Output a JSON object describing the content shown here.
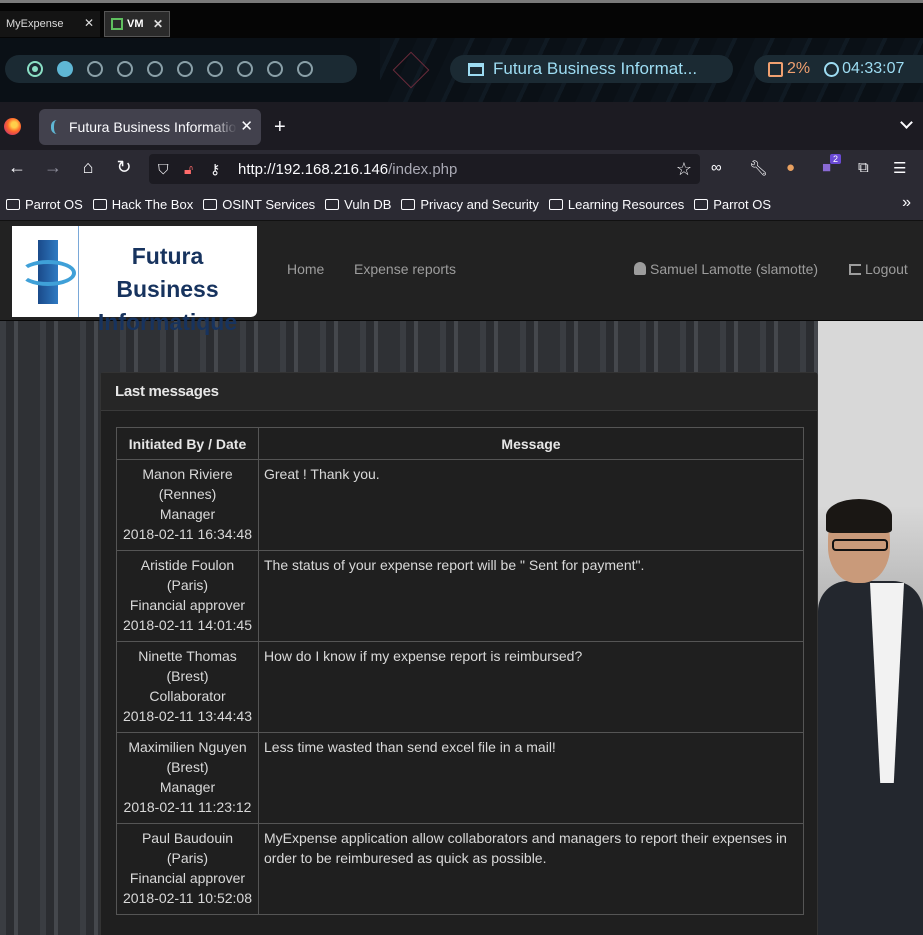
{
  "host": {
    "tabs": [
      {
        "label": "MyExpense"
      },
      {
        "label": "VM"
      }
    ]
  },
  "panel": {
    "window_title": "Futura Business Informat...",
    "cpu": "2%",
    "clock": "04:33:07"
  },
  "browser": {
    "tab_title": "Futura Business Informatio",
    "url_host": "http://192.168.216.146",
    "url_path": "/index.php",
    "extension_badge": "2",
    "bookmarks": [
      {
        "label": "Parrot OS"
      },
      {
        "label": "Hack The Box"
      },
      {
        "label": "OSINT Services"
      },
      {
        "label": "Vuln DB"
      },
      {
        "label": "Privacy and Security"
      },
      {
        "label": "Learning Resources"
      },
      {
        "label": "Parrot OS"
      }
    ]
  },
  "site": {
    "logo_line1": "Futura Business",
    "logo_line2": "Informatique",
    "nav": {
      "home": "Home",
      "expense_reports": "Expense reports",
      "user": "Samuel Lamotte (slamotte)",
      "logout": "Logout"
    },
    "panel_title": "Last messages",
    "table": {
      "headers": [
        "Initiated By / Date",
        "Message"
      ],
      "rows": [
        {
          "name": "Manon Riviere",
          "city": "(Rennes)",
          "role": "Manager",
          "date": "2018-02-11 16:34:48",
          "message": "Great ! Thank you."
        },
        {
          "name": "Aristide Foulon",
          "city": "(Paris)",
          "role": "Financial approver",
          "date": "2018-02-11 14:01:45",
          "message": "The status of your expense report will be \" Sent for payment\"."
        },
        {
          "name": "Ninette Thomas",
          "city": "(Brest)",
          "role": "Collaborator",
          "date": "2018-02-11 13:44:43",
          "message": "How do I know if my expense report is reimbursed?"
        },
        {
          "name": "Maximilien Nguyen",
          "city": "(Brest)",
          "role": "Manager",
          "date": "2018-02-11 11:23:12",
          "message": "Less time wasted than send excel file in a mail!"
        },
        {
          "name": "Paul Baudouin",
          "city": "(Paris)",
          "role": "Financial approver",
          "date": "2018-02-11 10:52:08",
          "message": "MyExpense application allow collaborators and managers to report their expenses in order to be reimburesed as quick as possible."
        }
      ]
    }
  }
}
